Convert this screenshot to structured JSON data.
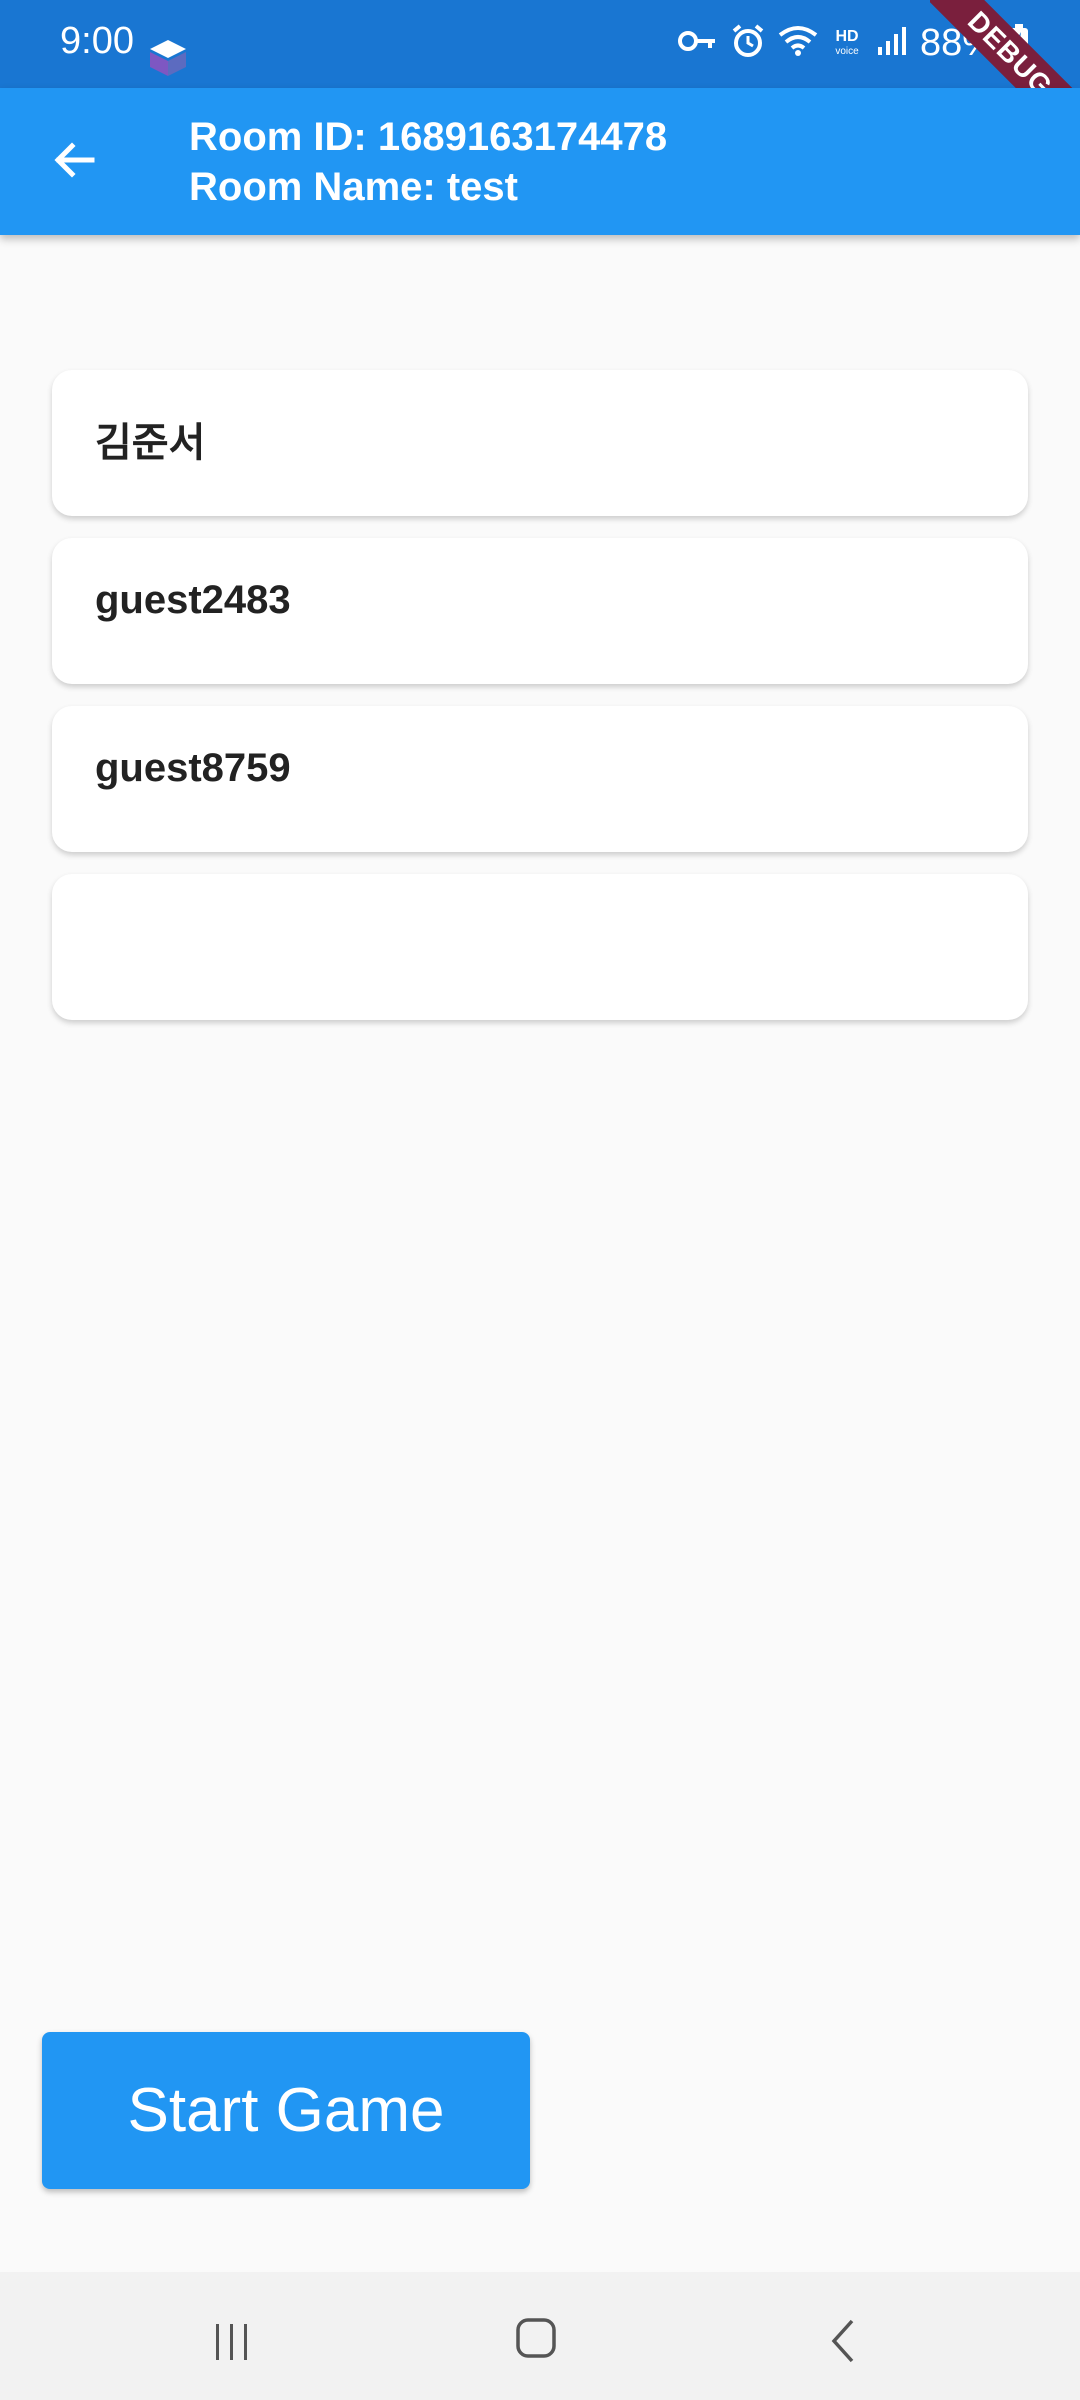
{
  "status_bar": {
    "time": "9:00",
    "battery": "88%",
    "icons": [
      "app-notification-icon",
      "vpn-key-icon",
      "alarm-icon",
      "wifi-icon",
      "hd-voice-icon",
      "signal-icon",
      "battery-charging-icon"
    ]
  },
  "debug_banner": "DEBUG",
  "app_bar": {
    "room_id": "Room ID: 1689163174478",
    "room_name": "Room Name: test"
  },
  "players": [
    {
      "name": "김준서"
    },
    {
      "name": "guest2483"
    },
    {
      "name": "guest8759"
    },
    {
      "name": ""
    }
  ],
  "start_button": "Start Game",
  "colors": {
    "status_bar": "#1976D2",
    "app_bar": "#2196F3",
    "background": "#FAFAFA",
    "card": "#FFFFFF",
    "debug_ribbon": "#7A1F3D"
  }
}
